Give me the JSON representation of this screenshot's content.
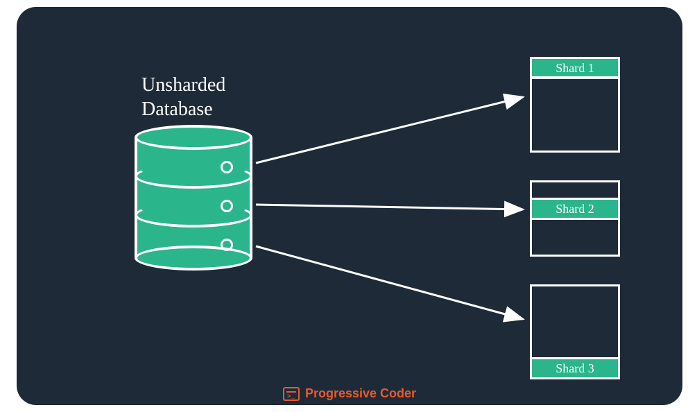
{
  "colors": {
    "background": "#1e2a38",
    "accent": "#2bb58a",
    "stroke": "#ffffff",
    "brand": "#e85a2c"
  },
  "database": {
    "label": "Unsharded\nDatabase"
  },
  "shards": [
    {
      "label": "Shard 1"
    },
    {
      "label": "Shard 2"
    },
    {
      "label": "Shard 3"
    }
  ],
  "footer": {
    "brand": "Progressive Coder"
  }
}
